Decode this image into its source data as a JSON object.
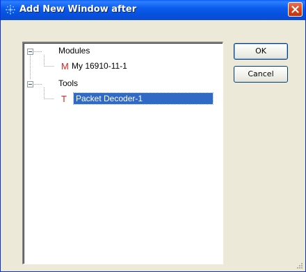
{
  "window": {
    "title": "Add New Window after"
  },
  "tree": {
    "groups": [
      {
        "label": "Modules",
        "expanded": true,
        "children": [
          {
            "type_letter": "M",
            "label": "My 16910-11-1",
            "selected": false
          }
        ]
      },
      {
        "label": "Tools",
        "expanded": true,
        "children": [
          {
            "type_letter": "T",
            "label": "Packet Decoder-1",
            "selected": true
          }
        ]
      }
    ]
  },
  "buttons": {
    "ok_label": "OK",
    "cancel_label": "Cancel"
  },
  "icons": {
    "title_icon": "app-sparkle-icon",
    "close_icon": "close-icon",
    "expander_icon": "minus-box-icon",
    "resize_icon": "resize-grip-icon"
  },
  "colors": {
    "titlebar": "#0b4cd1",
    "close_button": "#d9411b",
    "selection": "#316ac5",
    "type_letter": "#e8201b",
    "dialog_bg": "#ece9d8"
  }
}
